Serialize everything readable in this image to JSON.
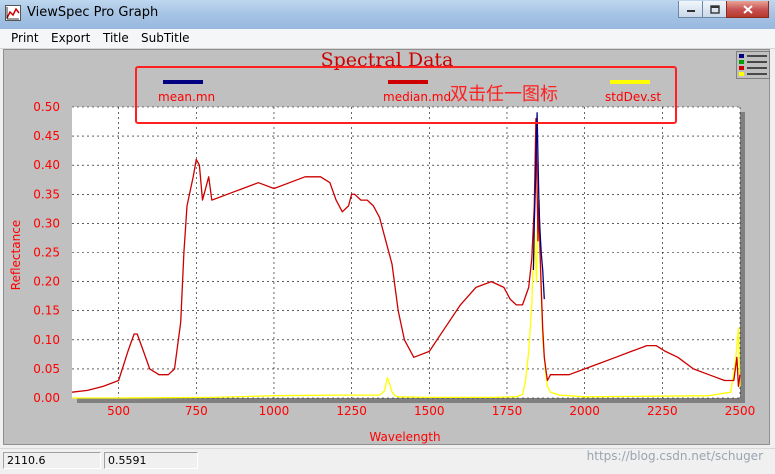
{
  "window": {
    "title": "ViewSpec Pro Graph"
  },
  "menu": [
    "Print",
    "Export",
    "Title",
    "SubTitle"
  ],
  "chart_data": {
    "type": "line",
    "title": "Spectral Data",
    "xlabel": "Wavelength",
    "ylabel": "Reflectance",
    "xlim": [
      350,
      2500
    ],
    "ylim": [
      0.0,
      0.5
    ],
    "xticks": [
      500,
      750,
      1000,
      1250,
      1500,
      1750,
      2000,
      2250,
      2500
    ],
    "yticks": [
      0.0,
      0.05,
      0.1,
      0.15,
      0.2,
      0.25,
      0.3,
      0.35,
      0.4,
      0.45,
      0.5
    ],
    "grid": true,
    "legend_position": "top",
    "annotation": "双击任一图标",
    "series": [
      {
        "name": "mean.mn",
        "color": "#000080",
        "x": [
          1835,
          1838,
          1841,
          1844,
          1847,
          1850,
          1853,
          1856,
          1860,
          1865,
          1870
        ],
        "y": [
          0.22,
          0.3,
          0.36,
          0.43,
          0.49,
          0.41,
          0.33,
          0.29,
          0.25,
          0.22,
          0.17
        ]
      },
      {
        "name": "median.md",
        "color": "#cc0000",
        "x": [
          350,
          400,
          450,
          500,
          530,
          550,
          560,
          580,
          600,
          630,
          660,
          680,
          700,
          710,
          720,
          740,
          750,
          760,
          770,
          780,
          790,
          800,
          850,
          900,
          950,
          1000,
          1050,
          1100,
          1150,
          1180,
          1200,
          1220,
          1240,
          1250,
          1260,
          1280,
          1300,
          1320,
          1340,
          1360,
          1370,
          1380,
          1400,
          1420,
          1450,
          1500,
          1550,
          1600,
          1650,
          1700,
          1740,
          1760,
          1780,
          1800,
          1820,
          1830,
          1838,
          1843,
          1847,
          1850,
          1853,
          1856,
          1860,
          1865,
          1870,
          1875,
          1880,
          1890,
          1900,
          1950,
          2000,
          2050,
          2100,
          2150,
          2200,
          2230,
          2260,
          2300,
          2350,
          2400,
          2450,
          2480,
          2490,
          2495,
          2500
        ],
        "y": [
          0.01,
          0.013,
          0.02,
          0.03,
          0.08,
          0.11,
          0.11,
          0.08,
          0.05,
          0.04,
          0.04,
          0.05,
          0.13,
          0.25,
          0.33,
          0.38,
          0.41,
          0.4,
          0.34,
          0.36,
          0.38,
          0.34,
          0.35,
          0.36,
          0.37,
          0.36,
          0.37,
          0.38,
          0.38,
          0.37,
          0.34,
          0.32,
          0.33,
          0.35,
          0.35,
          0.34,
          0.34,
          0.33,
          0.31,
          0.27,
          0.25,
          0.23,
          0.15,
          0.1,
          0.07,
          0.08,
          0.12,
          0.16,
          0.19,
          0.2,
          0.19,
          0.17,
          0.16,
          0.16,
          0.19,
          0.24,
          0.33,
          0.48,
          0.36,
          0.27,
          0.34,
          0.26,
          0.19,
          0.12,
          0.07,
          0.05,
          0.03,
          0.04,
          0.04,
          0.04,
          0.05,
          0.06,
          0.07,
          0.08,
          0.09,
          0.09,
          0.08,
          0.07,
          0.05,
          0.04,
          0.03,
          0.03,
          0.07,
          0.02,
          0.04
        ]
      },
      {
        "name": "stdDev.st",
        "color": "#ffff00",
        "x": [
          350,
          500,
          800,
          1000,
          1200,
          1340,
          1355,
          1365,
          1375,
          1380,
          1390,
          1400,
          1500,
          1700,
          1780,
          1800,
          1810,
          1820,
          1830,
          1838,
          1845,
          1850,
          1855,
          1860,
          1865,
          1870,
          1875,
          1880,
          1890,
          1920,
          2000,
          2200,
          2400,
          2470,
          2485,
          2495,
          2500
        ],
        "y": [
          0.0,
          0.0,
          0.001,
          0.004,
          0.005,
          0.005,
          0.012,
          0.035,
          0.02,
          0.01,
          0.004,
          0.002,
          0.001,
          0.001,
          0.002,
          0.006,
          0.03,
          0.08,
          0.16,
          0.29,
          0.2,
          0.36,
          0.27,
          0.18,
          0.1,
          0.07,
          0.04,
          0.02,
          0.01,
          0.005,
          0.002,
          0.003,
          0.004,
          0.01,
          0.06,
          0.12,
          0.02
        ]
      }
    ]
  },
  "status": {
    "x_value": "2110.6",
    "y_value": "0.5591"
  },
  "watermark": "https://blog.csdn.net/schuger",
  "colors": {
    "axis_text": "#ff0000",
    "annotation_border": "#ff2020",
    "plot_bg": "#ffffff",
    "panel_bg": "#c0c0c0"
  }
}
